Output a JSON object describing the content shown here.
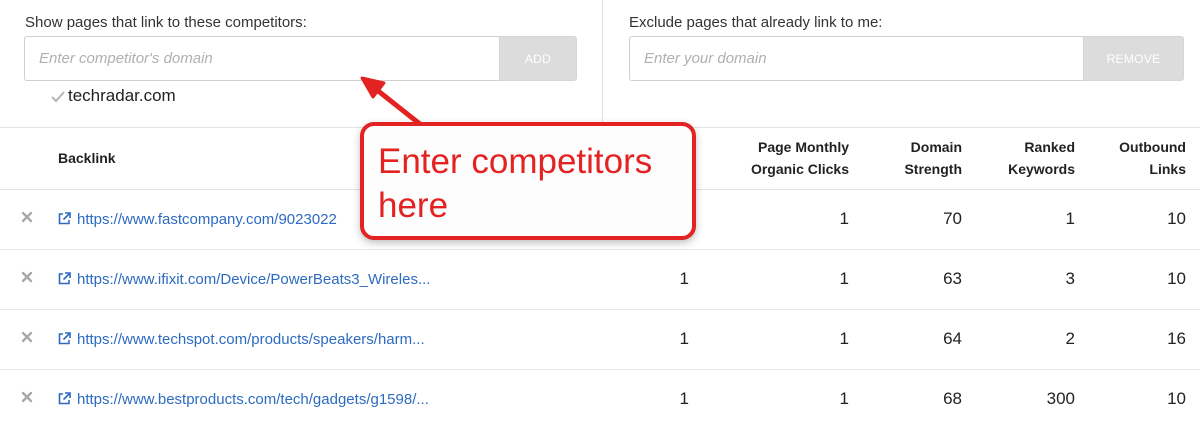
{
  "filters": {
    "include": {
      "label": "Show pages that link to these competitors:",
      "placeholder": "Enter competitor's domain",
      "button_label": "ADD",
      "competitors": [
        "techradar.com"
      ]
    },
    "exclude": {
      "label": "Exclude pages that already link to me:",
      "placeholder": "Enter your domain",
      "button_label": "REMOVE"
    }
  },
  "table": {
    "columns": {
      "backlink": "Backlink",
      "c1": "",
      "c2_line1": "Page Monthly",
      "c2_line2": "Organic Clicks",
      "c3_line1": "Domain",
      "c3_line2": "Strength",
      "c4_line1": "Ranked",
      "c4_line2": "Keywords",
      "c5_line1": "Outbound",
      "c5_line2": "Links"
    },
    "rows": [
      {
        "url": "https://www.fastcompany.com/9023022",
        "c1": "",
        "c2": "1",
        "c3": "70",
        "c4": "1",
        "c5": "10"
      },
      {
        "url": "https://www.ifixit.com/Device/PowerBeats3_Wireles...",
        "c1": "1",
        "c2": "1",
        "c3": "63",
        "c4": "3",
        "c5": "10"
      },
      {
        "url": "https://www.techspot.com/products/speakers/harm...",
        "c1": "1",
        "c2": "1",
        "c3": "64",
        "c4": "2",
        "c5": "16"
      },
      {
        "url": "https://www.bestproducts.com/tech/gadgets/g1598/...",
        "c1": "1",
        "c2": "1",
        "c3": "68",
        "c4": "300",
        "c5": "10"
      }
    ]
  },
  "annotation": {
    "line1": "Enter competitors",
    "line2": "here",
    "color": "#e32222"
  },
  "colors": {
    "link": "#2d6bc1",
    "button_bg": "#dcdcdc",
    "border": "#e3e3e3"
  },
  "icons": [
    "check-icon",
    "remove-x-icon",
    "external-link-icon",
    "arrow-icon"
  ]
}
